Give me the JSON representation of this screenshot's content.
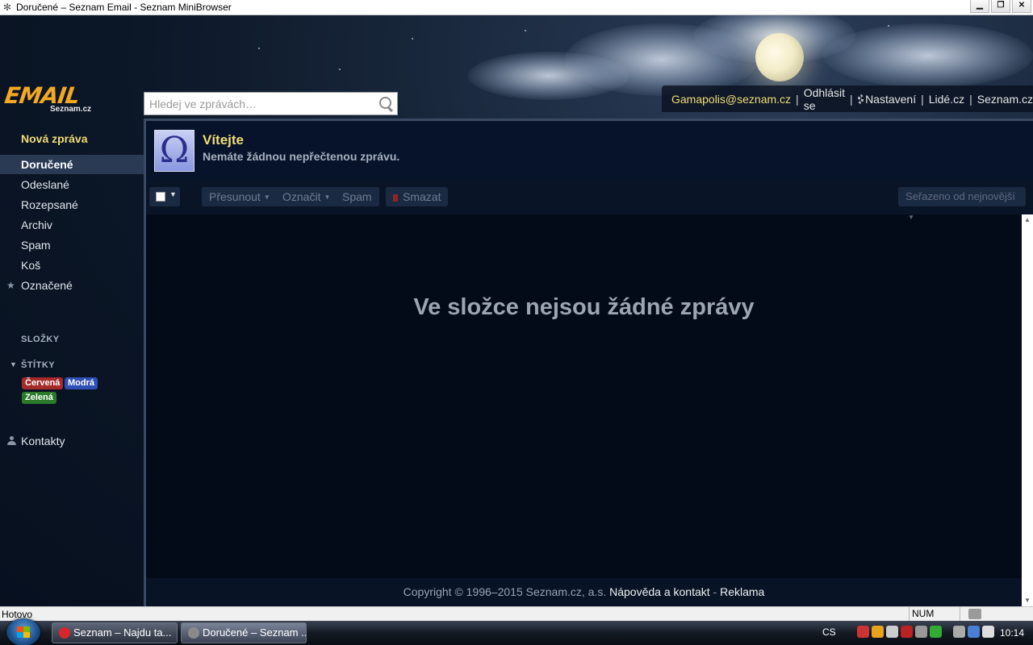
{
  "window": {
    "title": "Doručené – Seznam Email - Seznam MiniBrowser",
    "controls": [
      "minimize",
      "restore",
      "close"
    ]
  },
  "header": {
    "logo_text": "EMAIL",
    "logo_sub": "Seznam.cz",
    "search_placeholder": "Hledej ve zprávách…",
    "user_email": "Gamapolis@seznam.cz",
    "logout": "Odhlásit se",
    "settings": "Nastavení",
    "lide": "Lidé.cz",
    "seznam": "Seznam.cz"
  },
  "sidebar": {
    "new_message": "Nová zpráva",
    "folders": [
      {
        "label": "Doručené",
        "active": true
      },
      {
        "label": "Odeslané"
      },
      {
        "label": "Rozepsané"
      },
      {
        "label": "Archiv"
      },
      {
        "label": "Spam"
      },
      {
        "label": "Koš"
      },
      {
        "label": "Označené"
      }
    ],
    "folders_section": "SLOŽKY",
    "labels_section": "ŠTÍTKY",
    "tags": [
      {
        "label": "Červená",
        "color": "#a52a2a"
      },
      {
        "label": "Modrá",
        "color": "#2f4fb5"
      },
      {
        "label": "Zelená",
        "color": "#2a7a2a"
      }
    ],
    "contacts": "Kontakty"
  },
  "welcome": {
    "title": "Vítejte",
    "subtitle": "Nemáte žádnou nepřečtenou zprávu."
  },
  "toolbar": {
    "move": "Přesunout",
    "mark": "Označit",
    "spam": "Spam",
    "delete": "Smazat",
    "sort": "Seřazeno od nejnovější"
  },
  "main": {
    "empty_message": "Ve složce nejsou žádné zprávy"
  },
  "footer": {
    "copyright": "Copyright © 1996–2015 Seznam.cz, a.s.",
    "help": "Nápověda a kontakt",
    "separator": "-",
    "ads": "Reklama"
  },
  "statusbar": {
    "status": "Hotovo",
    "num": "NUM"
  },
  "taskbar": {
    "tasks": [
      {
        "label": "Seznam – Najdu ta..."
      },
      {
        "label": "Doručené – Seznam ..."
      }
    ],
    "language": "CS",
    "clock": "10:14"
  },
  "colors": {
    "accent_yellow": "#f2dd76",
    "logo_orange": "#f3a722",
    "background": "#07101f"
  }
}
